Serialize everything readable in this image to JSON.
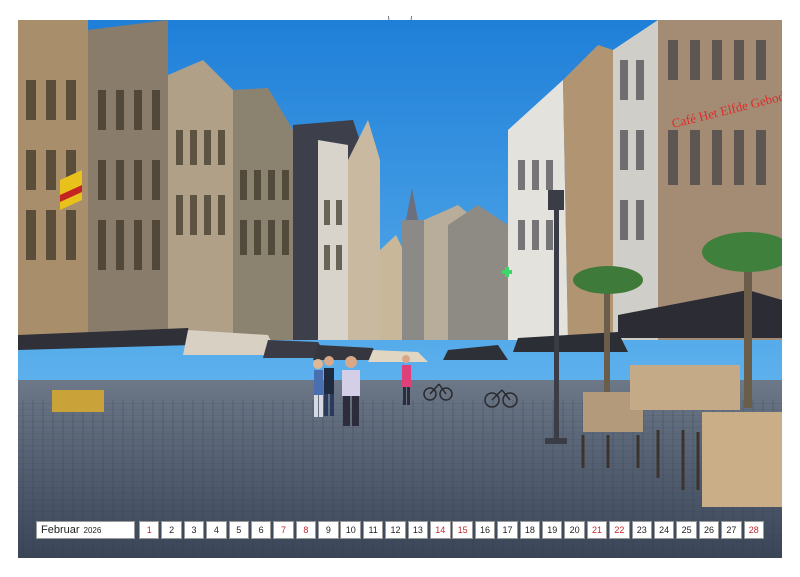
{
  "calendar": {
    "month": "Februar",
    "year": "2026",
    "days": [
      {
        "n": "1",
        "weekend": true
      },
      {
        "n": "2",
        "weekend": false
      },
      {
        "n": "3",
        "weekend": false
      },
      {
        "n": "4",
        "weekend": false
      },
      {
        "n": "5",
        "weekend": false
      },
      {
        "n": "6",
        "weekend": false
      },
      {
        "n": "7",
        "weekend": true
      },
      {
        "n": "8",
        "weekend": true
      },
      {
        "n": "9",
        "weekend": false
      },
      {
        "n": "10",
        "weekend": false
      },
      {
        "n": "11",
        "weekend": false
      },
      {
        "n": "12",
        "weekend": false
      },
      {
        "n": "13",
        "weekend": false
      },
      {
        "n": "14",
        "weekend": true
      },
      {
        "n": "15",
        "weekend": true
      },
      {
        "n": "16",
        "weekend": false
      },
      {
        "n": "17",
        "weekend": false
      },
      {
        "n": "18",
        "weekend": false
      },
      {
        "n": "19",
        "weekend": false
      },
      {
        "n": "20",
        "weekend": false
      },
      {
        "n": "21",
        "weekend": true
      },
      {
        "n": "22",
        "weekend": true
      },
      {
        "n": "23",
        "weekend": false
      },
      {
        "n": "24",
        "weekend": false
      },
      {
        "n": "25",
        "weekend": false
      },
      {
        "n": "26",
        "weekend": false
      },
      {
        "n": "27",
        "weekend": false
      },
      {
        "n": "28",
        "weekend": true
      }
    ]
  },
  "photo": {
    "sign_text": "Café Het Elfde Gebod",
    "colors": {
      "sky": "#2b8fe0",
      "cobblestone": "#4a5a70",
      "building_dark": "#2a2c34"
    }
  }
}
